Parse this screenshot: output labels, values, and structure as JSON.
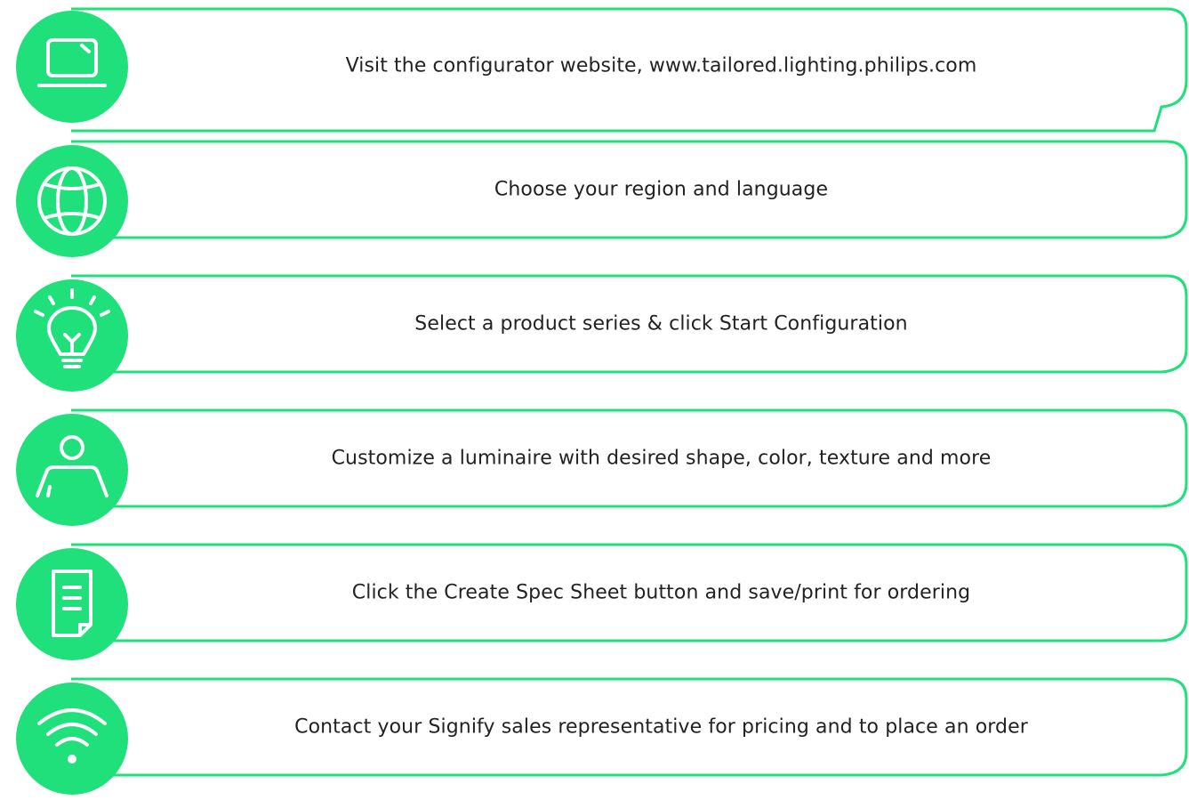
{
  "colors": {
    "accent": "#1fe07a",
    "frame_border": "#1fe07a",
    "icon_stroke": "#ffffff",
    "text": "#222222"
  },
  "steps": [
    {
      "icon": "laptop-icon",
      "text": "Visit the configurator website, www.tailored.lighting.philips.com"
    },
    {
      "icon": "globe-icon",
      "text": "Choose your region and language"
    },
    {
      "icon": "lightbulb-icon",
      "text": "Select a product series & click Start Configuration"
    },
    {
      "icon": "person-at-desk-icon",
      "text": "Customize a luminaire with desired shape, color, texture and more"
    },
    {
      "icon": "document-icon",
      "text": "Click the Create Spec Sheet button and save/print for ordering"
    },
    {
      "icon": "wifi-icon",
      "text": "Contact your Signify sales representative for pricing and to place an order"
    }
  ]
}
